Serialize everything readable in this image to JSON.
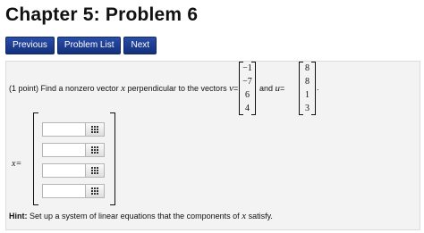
{
  "title": "Chapter 5: Problem 6",
  "nav": {
    "previous": "Previous",
    "problem_list": "Problem List",
    "next": "Next"
  },
  "problem": {
    "prefix": "(1 point) Find a nonzero vector",
    "x_name": "x",
    "middle": "perpendicular to the vectors",
    "v_name": "v",
    "eq": "=",
    "and": "and",
    "u_name": "u",
    "period": ".",
    "v": [
      "−1",
      "−7",
      "6",
      "4"
    ],
    "u": [
      "8",
      "8",
      "1",
      "3"
    ]
  },
  "answer": {
    "label": "x",
    "eq": "=",
    "inputs": [
      "",
      "",
      "",
      ""
    ],
    "keyboard_icon": "keyboard-icon"
  },
  "hint": {
    "label": "Hint:",
    "text": "Set up a system of linear equations that the components of",
    "x_name": "x",
    "suffix": "satisfy."
  }
}
